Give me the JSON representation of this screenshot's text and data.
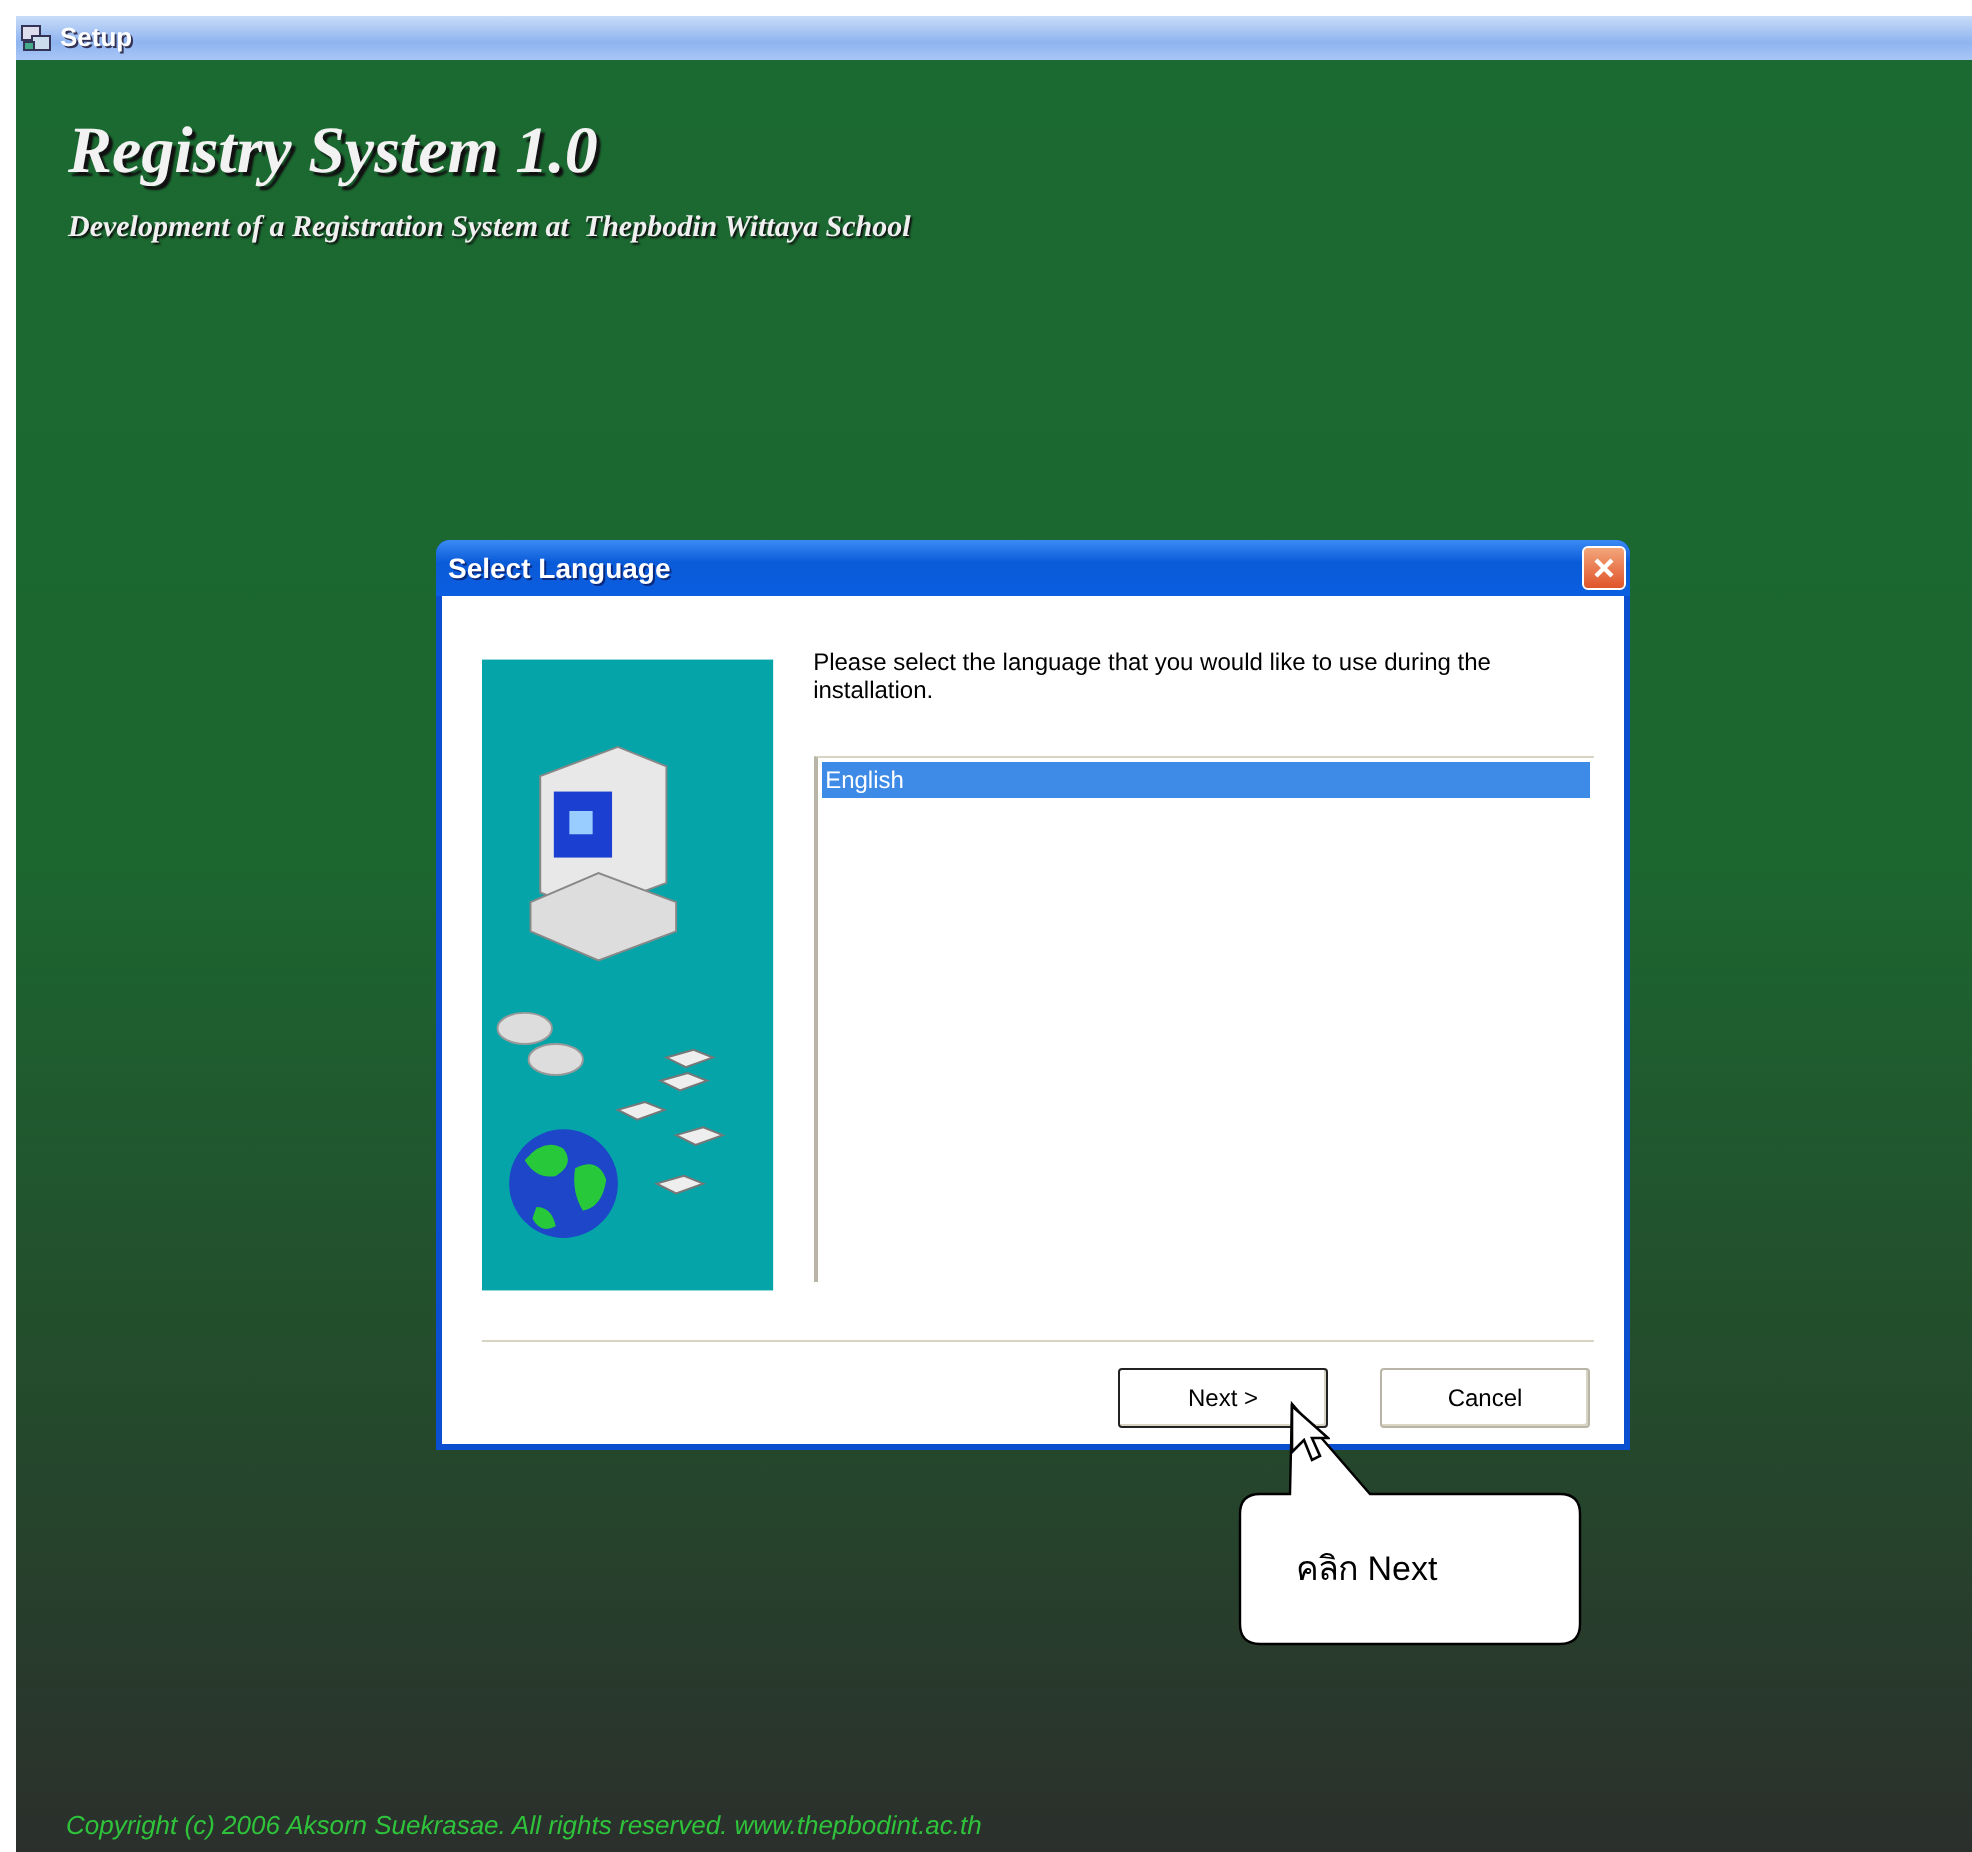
{
  "window": {
    "title": "Setup"
  },
  "product": {
    "title": "Registry System 1.0",
    "subtitle": "Development of a Registration System at  Thepbodin Wittaya School"
  },
  "dialog": {
    "title": "Select Language",
    "instruction": "Please select the language that you would like to use during the installation.",
    "languages": [
      {
        "label": "English",
        "selected": true
      }
    ],
    "buttons": [
      {
        "label": "Next >",
        "default": true
      },
      {
        "label": "Cancel",
        "default": false
      }
    ]
  },
  "callout": {
    "text": "คลิก Next"
  },
  "footer": {
    "copyright": "Copyright (c) 2006 Aksorn Suekrasae. All rights reserved. www.thepbodint.ac.th"
  }
}
